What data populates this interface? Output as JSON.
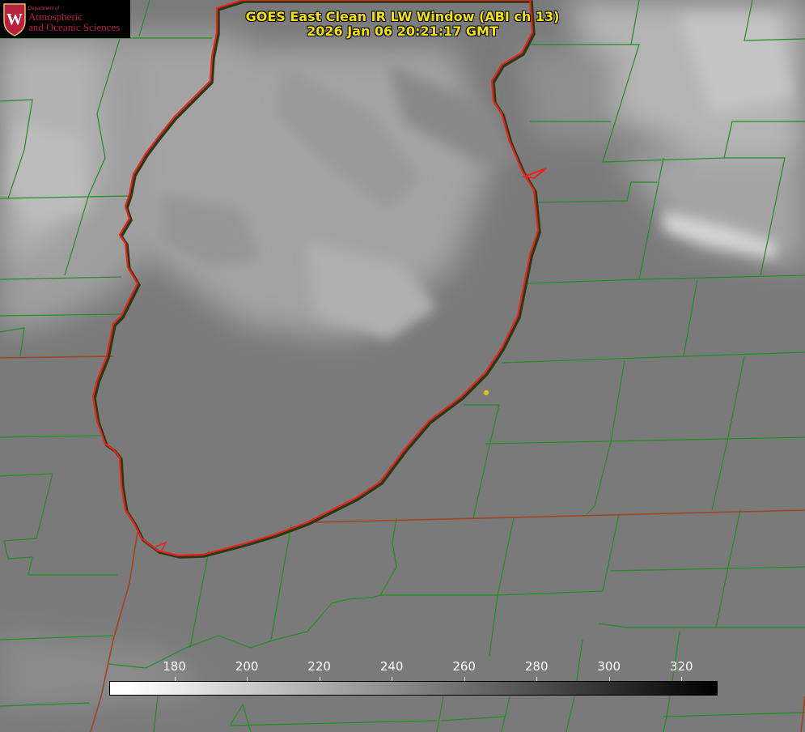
{
  "title": {
    "line1": "GOES East Clean IR LW Window (ABI ch 13)",
    "line2": "2026 Jan 06 20:21:17 GMT"
  },
  "logo": {
    "department": "Department of",
    "line1": "Atmospheric",
    "line2": "and Oceanic Sciences",
    "crest_letter": "W",
    "color": "#b6213c"
  },
  "colorbar": {
    "ticks": [
      "180",
      "200",
      "220",
      "240",
      "260",
      "280",
      "300",
      "320"
    ],
    "tick_values": [
      180,
      200,
      220,
      240,
      260,
      280,
      300,
      320
    ],
    "min_value": 162,
    "max_value": 330,
    "color_cold": "#ffffff",
    "color_warm": "#000000"
  },
  "map": {
    "lake_outline_color": "#e8231b",
    "county_line_color": "#1f8f1f",
    "state_line_color": "#a0451d",
    "marker_color": "#d8c21a"
  }
}
